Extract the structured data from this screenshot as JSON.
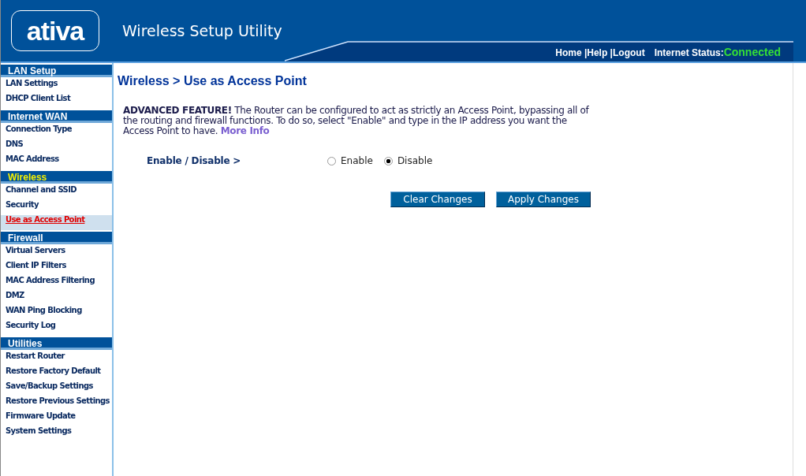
{
  "header": {
    "logo": "ativa",
    "title": "Wireless Setup Utility",
    "links": [
      "Home |",
      "Help |",
      "Logout"
    ],
    "status_label": "Internet Status:",
    "status_value": "Connected"
  },
  "sidebar": {
    "sections": [
      {
        "title": "LAN Setup",
        "selected": false,
        "items": [
          {
            "label": "LAN Settings",
            "selected": false
          },
          {
            "label": "DHCP Client List",
            "selected": false
          }
        ]
      },
      {
        "title": "Internet WAN",
        "selected": false,
        "items": [
          {
            "label": "Connection Type",
            "selected": false
          },
          {
            "label": "DNS",
            "selected": false
          },
          {
            "label": "MAC Address",
            "selected": false
          }
        ]
      },
      {
        "title": "Wireless",
        "selected": true,
        "items": [
          {
            "label": "Channel and SSID",
            "selected": false
          },
          {
            "label": "Security",
            "selected": false
          },
          {
            "label": "Use as Access Point",
            "selected": true
          }
        ]
      },
      {
        "title": "Firewall",
        "selected": false,
        "items": [
          {
            "label": "Virtual Servers",
            "selected": false
          },
          {
            "label": "Client IP Filters",
            "selected": false
          },
          {
            "label": "MAC Address Filtering",
            "selected": false
          },
          {
            "label": "DMZ",
            "selected": false
          },
          {
            "label": "WAN Ping Blocking",
            "selected": false
          },
          {
            "label": "Security Log",
            "selected": false
          }
        ]
      },
      {
        "title": "Utilities",
        "selected": false,
        "items": [
          {
            "label": "Restart Router",
            "selected": false
          },
          {
            "label": "Restore Factory Default",
            "selected": false
          },
          {
            "label": "Save/Backup Settings",
            "selected": false
          },
          {
            "label": "Restore Previous Settings",
            "selected": false
          },
          {
            "label": "Firmware Update",
            "selected": false
          },
          {
            "label": "System Settings",
            "selected": false
          }
        ]
      }
    ]
  },
  "main": {
    "heading": "Wireless > Use as Access Point",
    "description": "**ADVANCED FEATURE!** The Router can be configured to act as strictly an Access Point, bypassing all of the routing and firewall functions. To do so, select \"Enable\" and type in the IP address you want the Access Point to have.",
    "more_info": "More Info",
    "field_label": "Enable / Disable >",
    "options": [
      {
        "label": "Enable",
        "selected": false
      },
      {
        "label": "Disable",
        "selected": true
      }
    ],
    "buttons": [
      "Clear Changes",
      "Apply Changes"
    ]
  }
}
